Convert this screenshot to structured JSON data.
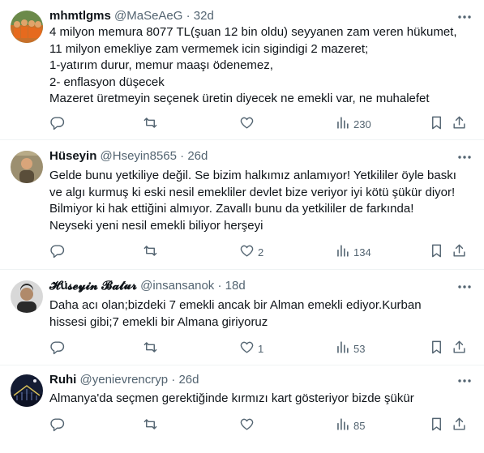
{
  "tweets": [
    {
      "name": "mhmtlgms",
      "handle": "@MaSeAeG",
      "time": "32d",
      "text": "4 milyon memura 8077 TL(şuan 12 bin oldu) seyyanen zam veren hükumet,\n11 milyon emekliye zam vermemek icin sigindigi 2 mazeret;\n1-yatırım durur, memur maaşı ödenemez,\n2- enflasyon düşecek\nMazeret üretmeyin seçenek üretin diyecek ne emekli var, ne muhalefet",
      "replies": "",
      "retweets": "",
      "likes": "",
      "views": "230",
      "avatar_color": "#c8702a"
    },
    {
      "name": "Hüseyin",
      "handle": "@Hseyin8565",
      "time": "26d",
      "text": "Gelde bunu yetkiliye değil. Se bizim halkımız anlamıyor! Yetkililer öyle baskı\nve algı kurmuş ki eski nesil emekliler devlet bize veriyor iyi kötü şükür diyor!\nBilmiyor ki hak ettiğini almıyor. Zavallı bunu da yetkililer de farkında!\nNeyseki yeni nesil emekli biliyor herşeyi",
      "replies": "",
      "retweets": "",
      "likes": "2",
      "views": "134",
      "avatar_color": "#8a7a5c"
    },
    {
      "name": "𝓗ü𝓼𝓮𝔂𝓲𝓷 𝓑𝓪𝓽𝓾𝓻",
      "handle": "@insansanok",
      "time": "18d",
      "text": "Daha acı olan;bizdeki 7 emekli ancak bir Alman emekli ediyor.Kurban\nhissesi gibi;7 emekli bir Almana giriyoruz",
      "replies": "",
      "retweets": "",
      "likes": "1",
      "views": "53",
      "avatar_color": "#3a3a3a"
    },
    {
      "name": "Ruhi",
      "handle": "@yenievrencryp",
      "time": "26d",
      "text": "Almanya'da seçmen gerektiğinde kırmızı kart gösteriyor bizde şükür",
      "replies": "",
      "retweets": "",
      "likes": "",
      "views": "85",
      "avatar_color": "#1a2440"
    }
  ],
  "separator": "·",
  "icons": {
    "reply": "reply-icon",
    "retweet": "retweet-icon",
    "like": "heart-icon",
    "views": "views-icon",
    "bookmark": "bookmark-icon",
    "share": "share-icon",
    "more": "more-icon"
  }
}
